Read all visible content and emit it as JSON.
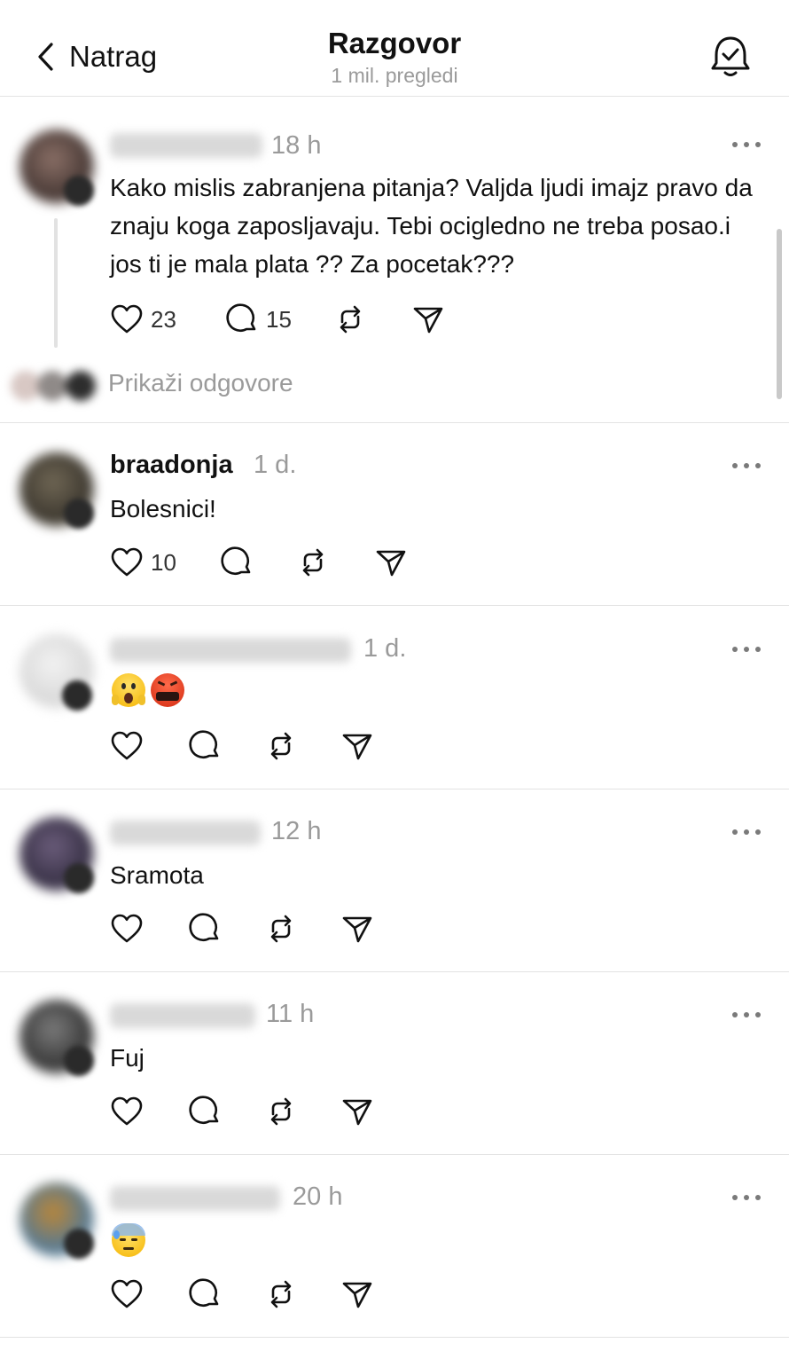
{
  "header": {
    "back_label": "Natrag",
    "title": "Razgovor",
    "subtitle": "1 mil. pregledi",
    "bell_icon": "bell-check-icon"
  },
  "posts": [
    {
      "username": "",
      "time": "18 h",
      "text": "Kako mislis zabranjena pitanja? Valjda ljudi imajz pravo da znaju koga zaposljavaju. Tebi ocigledno ne treba posao.i jos ti je mala plata ?? Za pocetak???",
      "likes": "23",
      "comments": "15",
      "show_replies_label": "Prikaži odgovore"
    },
    {
      "username": "braadonja",
      "time": "1 d.",
      "text": "Bolesnici!",
      "likes": "10",
      "comments": ""
    },
    {
      "username": "",
      "time": "1 d.",
      "emoji": [
        "😱",
        "🤬"
      ]
    },
    {
      "username": "",
      "time": "12 h",
      "text": "Sramota"
    },
    {
      "username": "",
      "time": "11 h",
      "text": "Fuj"
    },
    {
      "username": "",
      "time": "20 h",
      "emoji": [
        "😓"
      ]
    }
  ],
  "icons": {
    "like": "heart-icon",
    "comment": "comment-icon",
    "repost": "repost-icon",
    "share": "share-icon",
    "more": "more-icon"
  }
}
